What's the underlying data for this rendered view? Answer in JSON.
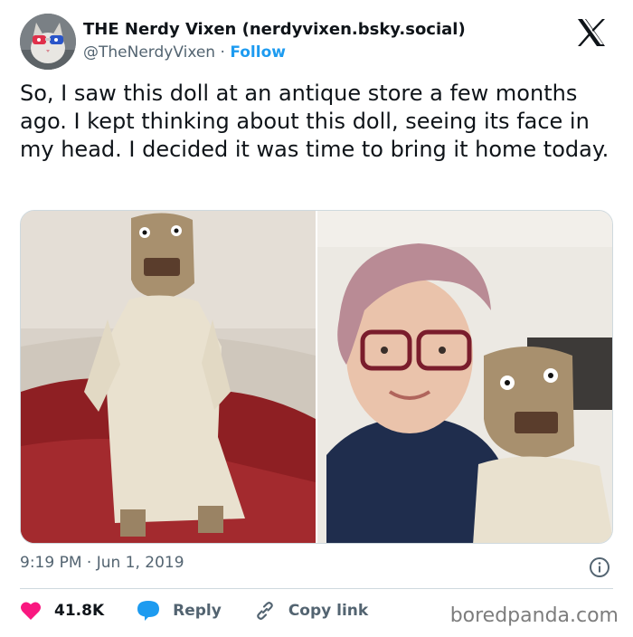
{
  "author": {
    "display_name": "THE Nerdy Vixen (nerdyvixen.bsky.social)",
    "handle": "@TheNerdyVixen",
    "separator": "·",
    "follow_label": "Follow",
    "avatar_icon": "cat-avatar-icon"
  },
  "platform_icon": "x-logo-icon",
  "tweet": {
    "text": "So, I saw this doll at an antique store a few months ago. I kept thinking about this doll, seeing its face in my head. I decided it was time to bring it home today.",
    "media": [
      {
        "icon": "doll-on-couch-photo"
      },
      {
        "icon": "woman-with-doll-selfie-photo"
      }
    ]
  },
  "meta": {
    "timestamp": "9:19 PM · Jun 1, 2019",
    "info_icon": "info-icon"
  },
  "actions": {
    "likes": "41.8K",
    "reply_label": "Reply",
    "copy_link_label": "Copy link",
    "like_color": "#f91880",
    "reply_color": "#1d9bf0"
  },
  "watermark": "boredpanda.com"
}
